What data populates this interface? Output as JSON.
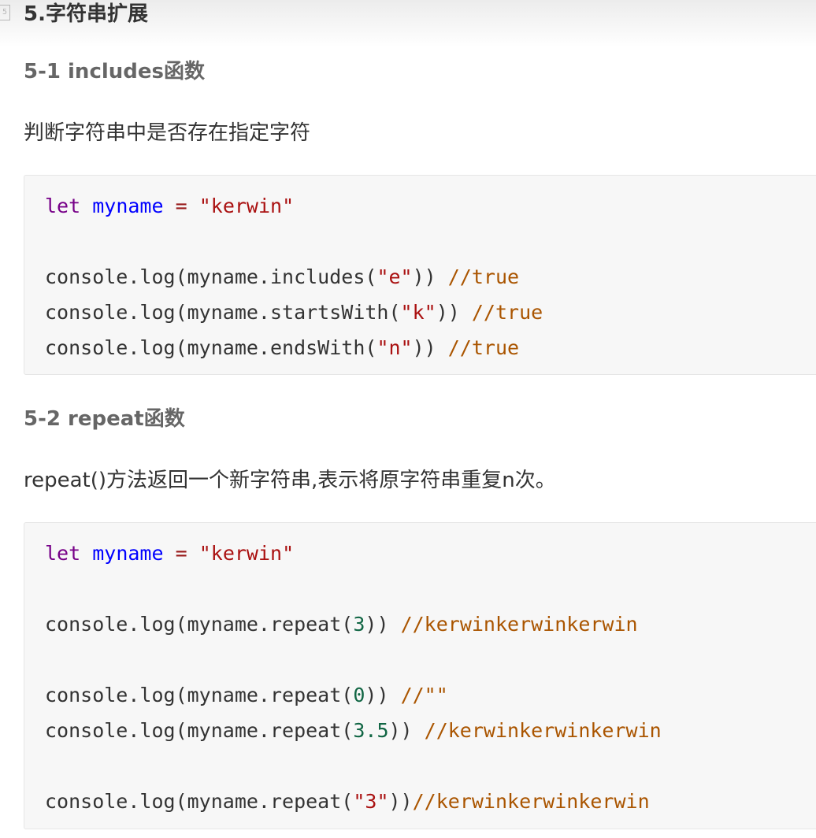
{
  "section": {
    "marker": "5",
    "title": "5.字符串扩展"
  },
  "part1": {
    "heading": "5-1 includes函数",
    "description": "判断字符串中是否存在指定字符",
    "code": {
      "line1": {
        "kw": "let",
        "var": "myname",
        "op": "=",
        "str": "\"kerwin\""
      },
      "line2": {
        "pre": "console.log(myname.includes(",
        "arg": "\"e\"",
        "post": ")) ",
        "comment": "//true"
      },
      "line3": {
        "pre": "console.log(myname.startsWith(",
        "arg": "\"k\"",
        "post": ")) ",
        "comment": "//true"
      },
      "line4": {
        "pre": "console.log(myname.endsWith(",
        "arg": "\"n\"",
        "post": ")) ",
        "comment": "//true"
      }
    }
  },
  "part2": {
    "heading": "5-2 repeat函数",
    "description": "repeat()方法返回一个新字符串,表示将原字符串重复n次。",
    "code": {
      "line1": {
        "kw": "let",
        "var": "myname",
        "op": "=",
        "str": "\"kerwin\""
      },
      "line2": {
        "pre": "console.log(myname.repeat(",
        "arg": "3",
        "post": ")) ",
        "comment": "//kerwinkerwinkerwin"
      },
      "line3": {
        "pre": "console.log(myname.repeat(",
        "arg": "0",
        "post": ")) ",
        "comment": "//\"\""
      },
      "line4": {
        "pre": "console.log(myname.repeat(",
        "arg": "3.5",
        "post": ")) ",
        "comment": "//kerwinkerwinkerwin"
      },
      "line5": {
        "pre": "console.log(myname.repeat(",
        "arg": "\"3\"",
        "post": "))",
        "comment": "//kerwinkerwinkerwin"
      }
    }
  }
}
